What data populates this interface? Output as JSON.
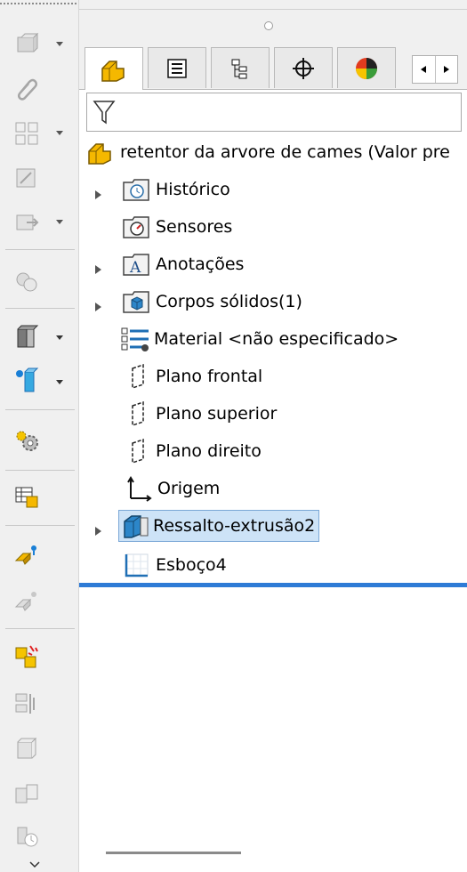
{
  "feature_tree": {
    "root_label": "retentor da arvore de cames  (Valor pre",
    "items": [
      {
        "label": "Histórico",
        "icon": "history-folder-icon",
        "expandable": true
      },
      {
        "label": "Sensores",
        "icon": "sensors-folder-icon",
        "expandable": false
      },
      {
        "label": "Anotações",
        "icon": "annotations-folder-icon",
        "expandable": true
      },
      {
        "label": "Corpos sólidos(1)",
        "icon": "solid-bodies-folder-icon",
        "expandable": true
      },
      {
        "label": "Material <não especificado>",
        "icon": "material-icon",
        "expandable": false
      },
      {
        "label": "Plano frontal",
        "icon": "plane-icon",
        "expandable": false
      },
      {
        "label": "Plano superior",
        "icon": "plane-icon",
        "expandable": false
      },
      {
        "label": "Plano direito",
        "icon": "plane-icon",
        "expandable": false
      },
      {
        "label": "Origem",
        "icon": "origin-icon",
        "expandable": false
      },
      {
        "label": "Ressalto-extrusão2",
        "icon": "boss-extrude-icon",
        "expandable": true,
        "selected": true
      },
      {
        "label": "Esboço4",
        "icon": "sketch-icon",
        "expandable": false
      }
    ]
  },
  "tabs": [
    {
      "name": "featuremanager-tab",
      "icon": "part-icon"
    },
    {
      "name": "propertymanager-tab",
      "icon": "property-icon"
    },
    {
      "name": "configurationmanager-tab",
      "icon": "configuration-icon"
    },
    {
      "name": "dimxpert-tab",
      "icon": "crosshair-icon"
    },
    {
      "name": "appearance-tab",
      "icon": "appearance-icon"
    }
  ],
  "colors": {
    "selection": "#cde3f7",
    "selection_border": "#7aa7d6",
    "rollback_bar": "#2e7bd6",
    "part_icon": "#f5b800"
  }
}
